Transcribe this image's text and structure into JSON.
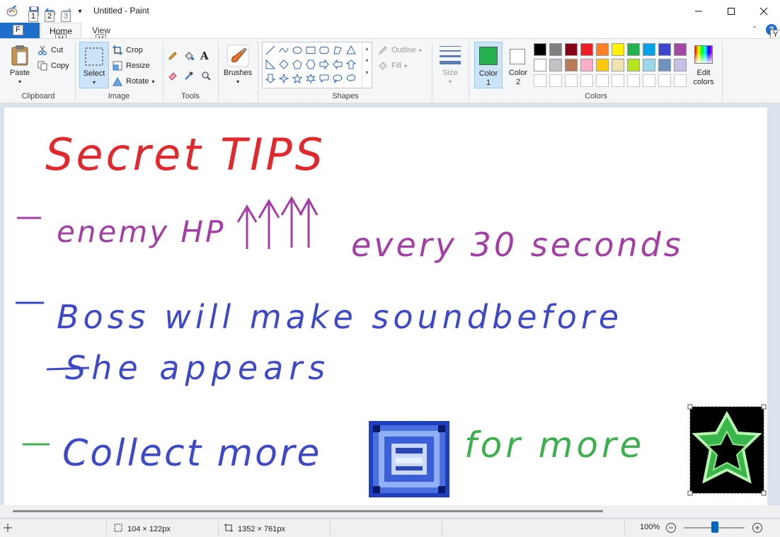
{
  "window": {
    "title": "Untitled - Paint",
    "quick_access_keytips": [
      "1",
      "2",
      "3"
    ]
  },
  "tabs": {
    "file": "F",
    "home": "Home",
    "home_keytip": "H",
    "view": "View",
    "view_keytip": "V",
    "help_keytip": "Y"
  },
  "ribbon": {
    "clipboard": {
      "label": "Clipboard",
      "paste": "Paste",
      "cut": "Cut",
      "copy": "Copy"
    },
    "image": {
      "label": "Image",
      "select": "Select",
      "crop": "Crop",
      "resize": "Resize",
      "rotate": "Rotate"
    },
    "tools": {
      "label": "Tools"
    },
    "brushes": {
      "label": "Brushes"
    },
    "shapes": {
      "label": "Shapes",
      "outline": "Outline",
      "fill": "Fill"
    },
    "size": {
      "label": "Size"
    },
    "colors": {
      "label": "Colors",
      "color1_label": "Color",
      "color1_num": "1",
      "color2_label": "Color",
      "color2_num": "2",
      "edit_label": "Edit",
      "edit_label2": "colors",
      "color1_value": "#22b14c",
      "color2_value": "#ffffff",
      "palette_row1": [
        "#000000",
        "#7f7f7f",
        "#880015",
        "#ed1c24",
        "#ff7f27",
        "#fff200",
        "#22b14c",
        "#00a2e8",
        "#3f48cc",
        "#a349a4"
      ],
      "palette_row2": [
        "#ffffff",
        "#c3c3c3",
        "#b97a57",
        "#ffaec9",
        "#ffc90e",
        "#efe4b0",
        "#b5e61d",
        "#99d9ea",
        "#7092be",
        "#c8bfe7"
      ]
    }
  },
  "canvas": {
    "heading": "Secret TIPS",
    "line1": "enemy HP",
    "line1b": "every 30 seconds",
    "line2": "Boss will make soundbefore",
    "line3": "She appears",
    "line4a": "Collect more",
    "line4b": "for more",
    "colors": {
      "red": "#e0282d",
      "purple": "#a33ea5",
      "blue": "#3d49c8",
      "green": "#3cb04c"
    }
  },
  "statusbar": {
    "selection_size": "104 × 122px",
    "canvas_size": "1352 × 761px",
    "zoom": "100%"
  }
}
